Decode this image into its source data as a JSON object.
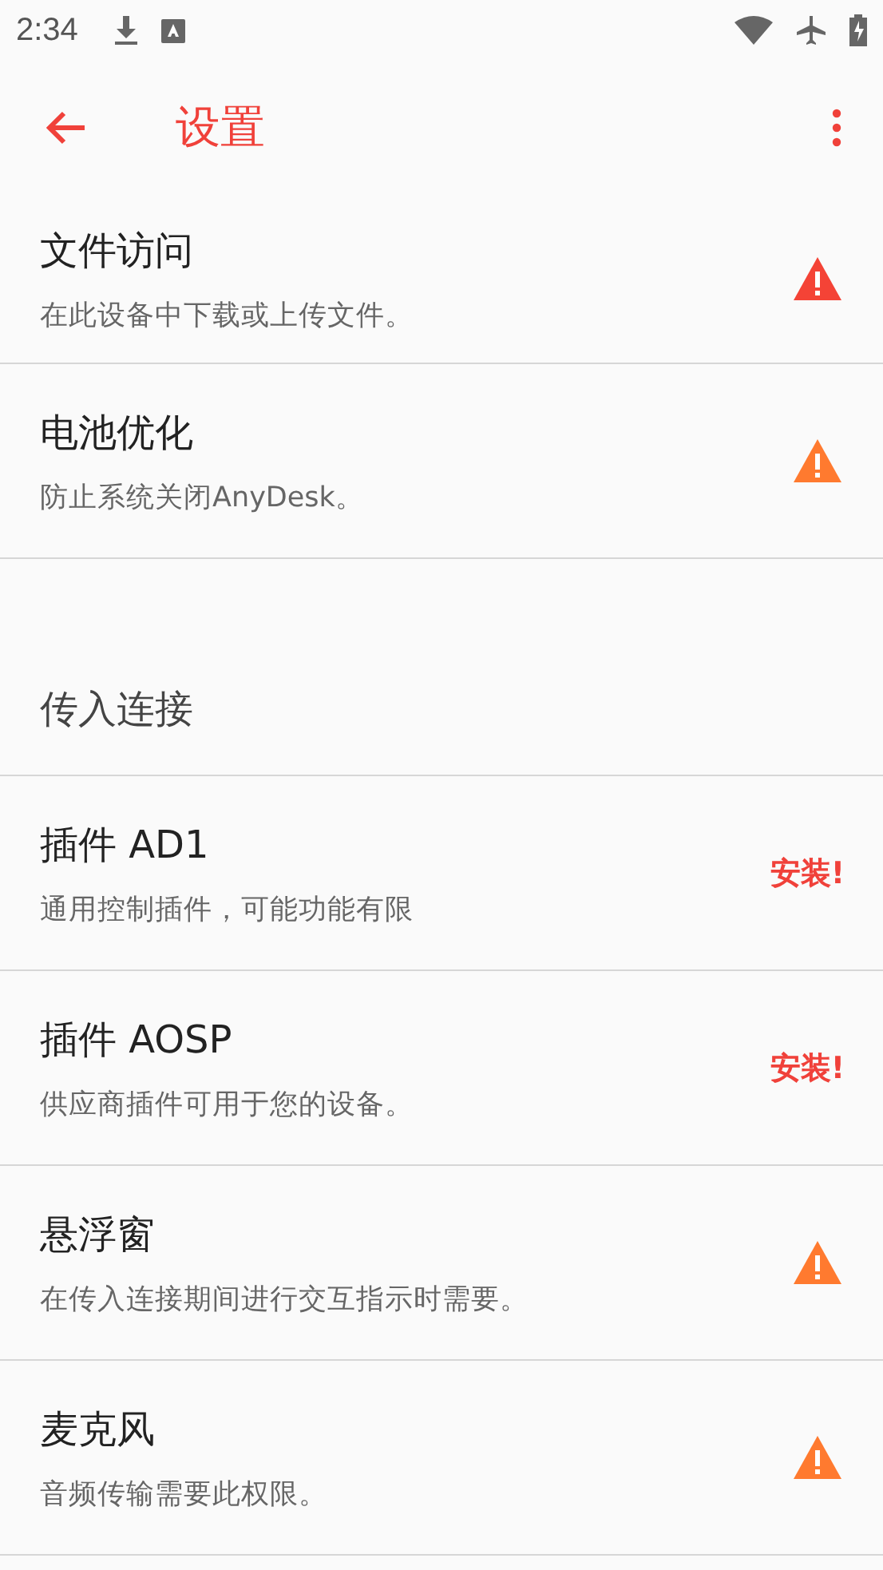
{
  "status_bar": {
    "time": "2:34"
  },
  "app_bar": {
    "title": "设置"
  },
  "sections": [
    {
      "items": [
        {
          "title": "文件访问",
          "subtitle": "在此设备中下载或上传文件。",
          "kind": "warning",
          "color": "#f44336"
        },
        {
          "title": "电池优化",
          "subtitle": "防止系统关闭AnyDesk。",
          "kind": "warning",
          "color": "#ff7a2f"
        }
      ]
    },
    {
      "header": "传入连接",
      "items": [
        {
          "title": "插件 AD1",
          "subtitle": "通用控制插件，可能功能有限",
          "kind": "install",
          "action": "安装!"
        },
        {
          "title": "插件 AOSP",
          "subtitle": "供应商插件可用于您的设备。",
          "kind": "install",
          "action": "安装!"
        },
        {
          "title": "悬浮窗",
          "subtitle": "在传入连接期间进行交互指示时需要。",
          "kind": "warning",
          "color": "#ff7a2f"
        },
        {
          "title": "麦克风",
          "subtitle": "音频传输需要此权限。",
          "kind": "warning",
          "color": "#ff7a2f"
        }
      ]
    }
  ]
}
